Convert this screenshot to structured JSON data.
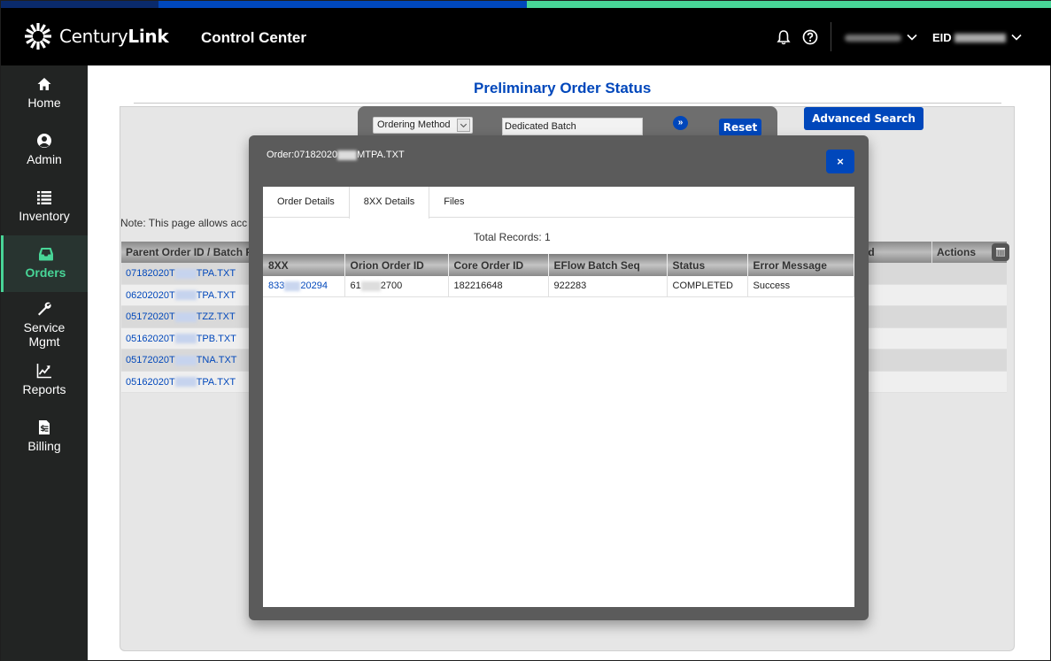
{
  "header": {
    "brand_light": "Century",
    "brand_bold": "Link",
    "app_title": "Control Center",
    "eid_label": "EID",
    "icons": [
      "bell-icon",
      "help-icon",
      "chevron-down-icon"
    ]
  },
  "colors": {
    "brand_blue": "#0047bb",
    "accent_green": "#48d597",
    "header_bg": "#000000",
    "sidebar_bg": "#222423"
  },
  "sidebar": {
    "items": [
      {
        "label": "Home",
        "icon": "home-icon"
      },
      {
        "label": "Admin",
        "icon": "user-circle-icon"
      },
      {
        "label": "Inventory",
        "icon": "list-icon"
      },
      {
        "label": "Orders",
        "icon": "inbox-icon",
        "active": true
      },
      {
        "label": "Service Mgmt",
        "icon": "wrench-icon"
      },
      {
        "label": "Reports",
        "icon": "chart-line-icon"
      },
      {
        "label": "Billing",
        "icon": "invoice-icon"
      }
    ]
  },
  "page": {
    "title": "Preliminary Order Status",
    "search": {
      "select_value": "Ordering Method",
      "input_value": "Dedicated Batch",
      "go_label": "»",
      "reset_label": "Reset",
      "advanced_label": "Advanced Search"
    },
    "note": "Note: This page allows acc",
    "table": {
      "columns": [
        "Parent Order ID / Batch F",
        "od",
        "Actions"
      ],
      "rows": [
        {
          "prefix": "07182020T",
          "suffix": "TPA.TXT"
        },
        {
          "prefix": "06202020T",
          "suffix": "TPA.TXT"
        },
        {
          "prefix": "05172020T",
          "suffix": "TZZ.TXT"
        },
        {
          "prefix": "05162020T",
          "suffix": "TPB.TXT"
        },
        {
          "prefix": "05172020T",
          "suffix": "TNA.TXT"
        },
        {
          "prefix": "05162020T",
          "suffix": "TPA.TXT"
        }
      ]
    }
  },
  "modal": {
    "title_prefix": "Order:07182020",
    "title_suffix": "MTPA.TXT",
    "close_label": "×",
    "tabs": [
      {
        "label": "Order Details"
      },
      {
        "label": "8XX Details",
        "active": true
      },
      {
        "label": "Files"
      }
    ],
    "total_records": "Total Records: 1",
    "grid": {
      "columns": [
        "8XX",
        "Orion Order ID",
        "Core Order ID",
        "EFlow Batch Seq",
        "Status",
        "Error Message"
      ],
      "rows": [
        {
          "n8xx_prefix": "833",
          "n8xx_suffix": "20294",
          "orion_prefix": "61",
          "orion_suffix": "2700",
          "core_order_id": "182216648",
          "eflow_batch_seq": "922283",
          "status": "COMPLETED",
          "error_message": "Success"
        }
      ]
    }
  }
}
